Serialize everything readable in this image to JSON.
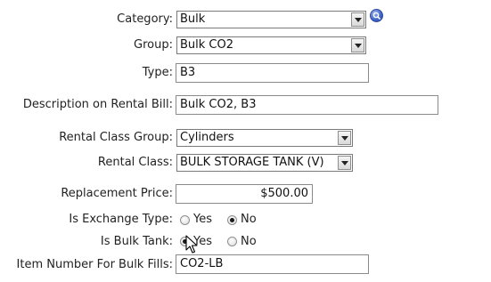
{
  "form": {
    "category": {
      "label": "Category:",
      "value": "Bulk"
    },
    "group": {
      "label": "Group:",
      "value": "Bulk CO2"
    },
    "type": {
      "label": "Type:",
      "value": "B3"
    },
    "description": {
      "label": "Description on Rental Bill:",
      "value": "Bulk CO2, B3"
    },
    "rental_class_group": {
      "label": "Rental Class Group:",
      "value": "Cylinders"
    },
    "rental_class": {
      "label": "Rental Class:",
      "value": "BULK STORAGE TANK (V)"
    },
    "replacement_price": {
      "label": "Replacement Price:",
      "value": "$500.00"
    },
    "is_exchange_type": {
      "label": "Is Exchange Type:",
      "yes": "Yes",
      "no": "No",
      "selected": "No"
    },
    "is_bulk_tank": {
      "label": "Is Bulk Tank:",
      "yes": "Yes",
      "no": "No",
      "selected": "Yes"
    },
    "item_number": {
      "label": "Item Number For Bulk Fills:",
      "value": "CO2-LB"
    }
  },
  "icons": {
    "search": "search-icon",
    "dropdown": "chevron-down-icon",
    "cursor": "mouse-pointer-icon"
  },
  "colors": {
    "search_button": "#3d63c8",
    "border": "#8a8a8a"
  }
}
